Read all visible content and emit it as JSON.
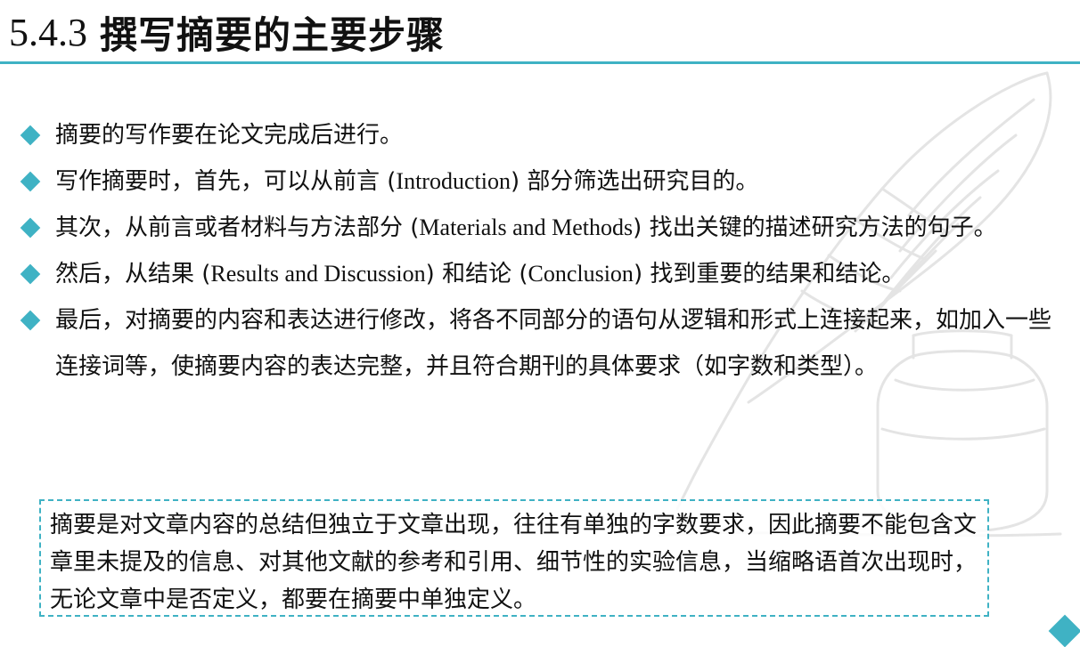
{
  "header": {
    "number": "5.4.3",
    "title": "撰写摘要的主要步骤"
  },
  "bullets": [
    {
      "text": "摘要的写作要在论文完成后进行。"
    },
    {
      "pre": "写作摘要时，首先，可以从前言  (",
      "latin": "Introduction",
      "post": ")  部分筛选出研究目的。"
    },
    {
      "pre": "其次，从前言或者材料与方法部分  (",
      "latin": "Materials and Methods",
      "post": ")  找出关键的描述研究方法的句子。"
    },
    {
      "pre": "然后，从结果  (",
      "latin": "Results and Discussion",
      "post": ")  和结论  (",
      "latin2": "Conclusion",
      "post2": ")  找到重要的结果和结论。"
    },
    {
      "text": "最后，对摘要的内容和表达进行修改，将各不同部分的语句从逻辑和形式上连接起来，如加入一些连接词等，使摘要内容的表达完整，并且符合期刊的具体要求（如字数和类型）。"
    }
  ],
  "note": "摘要是对文章内容的总结但独立于文章出现，往往有单独的字数要求，因此摘要不能包含文章里未提及的信息、对其他文献的参考和引用、细节性的实验信息，当缩略语首次出现时，无论文章中是否定义，都要在摘要中单独定义。",
  "colors": {
    "accent": "#3fb2c4",
    "text": "#111111",
    "art": "#e3e3e3"
  },
  "icons": {
    "bullet": "diamond-bullet-icon",
    "background": "quill-and-inkwell-illustration",
    "corner": "diamond-corner-icon"
  }
}
